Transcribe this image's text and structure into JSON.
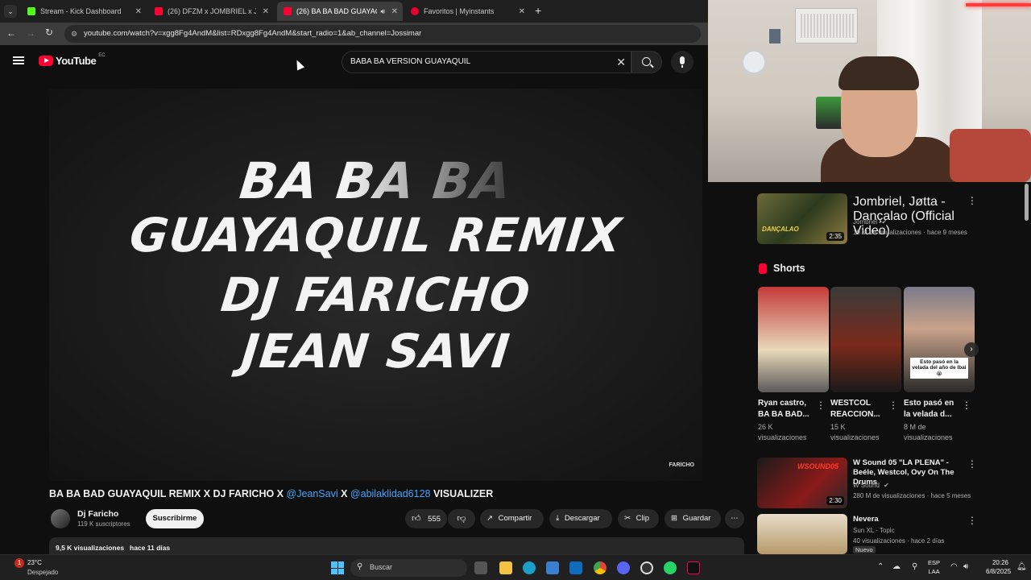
{
  "browser": {
    "tabs": [
      {
        "title": "Stream - Kick Dashboard",
        "favicon_color": "#53fc18"
      },
      {
        "title": "(26) DFZM x JOMBRIEL x JOWELL",
        "favicon_color": "#ff0033"
      },
      {
        "title": "(26) BA BA BAD GUAYAQUIL",
        "favicon_color": "#ff0033"
      },
      {
        "title": "Favoritos | Myinstants",
        "favicon_color": "#e8002d"
      }
    ],
    "url": "youtube.com/watch?v=xgg8Fg4AndM&list=RDxgg8Fg4AndM&start_radio=1&ab_channel=Jossimar"
  },
  "youtube": {
    "logo_text": "YouTube",
    "region": "EC",
    "search_value": "BABA BA VERSION GUAYAQUIL",
    "video_lines": [
      "BA BA BA",
      "GUAYAQUIL REMIX",
      "DJ FARICHO",
      "JEAN SAVI"
    ],
    "watermark": "FARICHO",
    "title_parts": {
      "a": "BA BA BAD GUAYAQUIL REMIX X DJ FARICHO X ",
      "b": "@JeanSavi",
      "c": " X ",
      "d": "@abilaklidad6128",
      "e": " VISUALIZER"
    },
    "channel": {
      "name": "Dj Faricho",
      "subs": "119 K suscriptores",
      "subscribe": "Suscribirme"
    },
    "actions": {
      "likes": "555",
      "share": "Compartir",
      "download": "Descargar",
      "clip": "Clip",
      "save": "Guardar"
    },
    "stats": {
      "views": "9,5 K visualizaciones",
      "date": "hace 11 días"
    }
  },
  "sidebar": {
    "videos_top": [
      {
        "title": "Jombriel, Jøtta - Dançalao (Official Video)",
        "channel": "Jombriel",
        "meta": "19 M de visualizaciones · hace 9 meses",
        "duration": "2:35",
        "thumb_text": "DANÇALAO"
      }
    ],
    "shorts_heading": "Shorts",
    "shorts": [
      {
        "title": "Ryan castro, BA BA BAD...",
        "views": "26 K visualizaciones"
      },
      {
        "title": "WESTCOL REACCION...",
        "views": "15 K visualizaciones"
      },
      {
        "title": "Esto pasó en la velada d...",
        "views": "8 M de visualizaciones",
        "overlay": "Esto pasó en la velada del año de Ibai 😭"
      }
    ],
    "videos_bottom": [
      {
        "title": "W Sound 05 \"LA PLENA\" - Beéle, Westcol, Ovy On The Drums",
        "channel": "W Sound",
        "meta": "280 M de visualizaciones · hace 5 meses",
        "duration": "2:30",
        "thumb_text": "WSOUND05"
      },
      {
        "title": "Nevera",
        "channel": "Sun XL - Topic",
        "meta": "40 visualizaciones · hace 2 días",
        "badge": "Nuevo"
      }
    ]
  },
  "taskbar": {
    "weather": {
      "temp": "23°C",
      "desc": "Despejado",
      "badge": "1"
    },
    "search_placeholder": "Buscar",
    "lang": {
      "line1": "ESP",
      "line2": "LAA"
    },
    "clock": {
      "time": "20:26",
      "date": "6/8/2025"
    }
  }
}
